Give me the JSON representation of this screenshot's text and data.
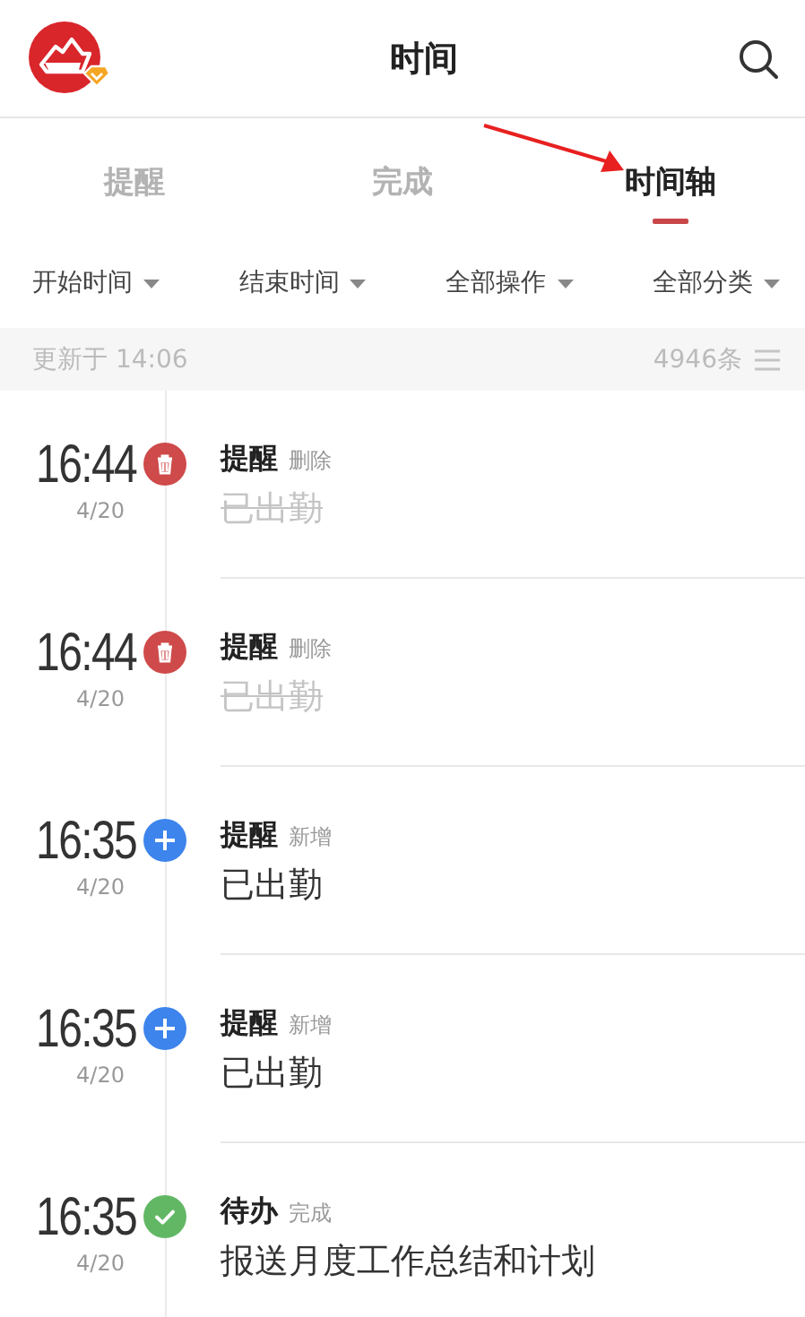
{
  "header": {
    "title": "时间"
  },
  "tabs": [
    {
      "label": "提醒",
      "selected": false
    },
    {
      "label": "完成",
      "selected": false
    },
    {
      "label": "时间轴",
      "selected": true
    }
  ],
  "filters": [
    "开始时间",
    "结束时间",
    "全部操作",
    "全部分类"
  ],
  "update_bar": {
    "updated": "更新于 14:06",
    "count": "4946条"
  },
  "entries": [
    {
      "time": "16:44",
      "date": "4/20",
      "kind": "delete",
      "category": "提醒",
      "action": "删除",
      "text": "已出勤"
    },
    {
      "time": "16:44",
      "date": "4/20",
      "kind": "delete",
      "category": "提醒",
      "action": "删除",
      "text": "已出勤"
    },
    {
      "time": "16:35",
      "date": "4/20",
      "kind": "add",
      "category": "提醒",
      "action": "新增",
      "text": "已出勤"
    },
    {
      "time": "16:35",
      "date": "4/20",
      "kind": "add",
      "category": "提醒",
      "action": "新增",
      "text": "已出勤"
    },
    {
      "time": "16:35",
      "date": "4/20",
      "kind": "complete",
      "category": "待办",
      "action": "完成",
      "text": "报送月度工作总结和计划"
    }
  ]
}
